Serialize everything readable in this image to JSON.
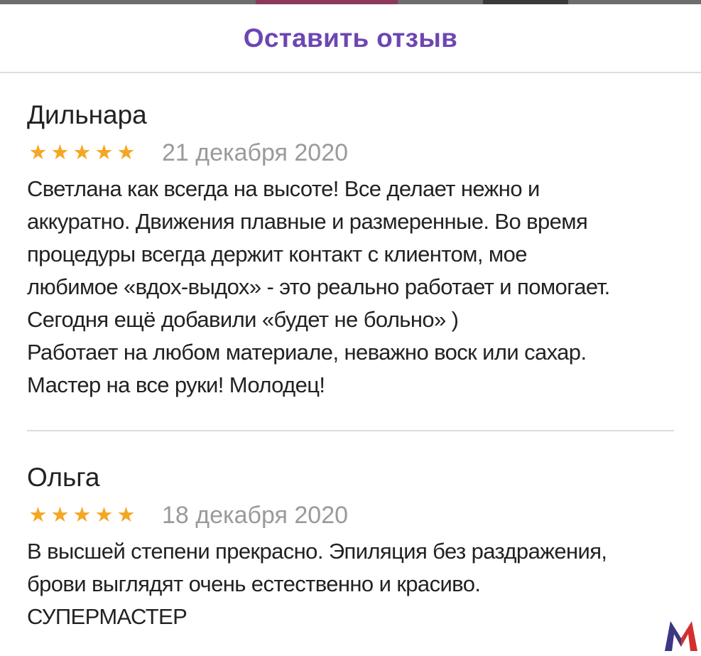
{
  "header": {
    "leave_review_label": "Оставить отзыв"
  },
  "reviews": [
    {
      "author": "Дильнара",
      "rating": 5,
      "stars": [
        "★",
        "★",
        "★",
        "★",
        "★"
      ],
      "date": "21 декабря 2020",
      "lines": [
        "Светлана как всегда на высоте! Все делает нежно и",
        "аккуратно. Движения плавные и размеренные. Во время",
        "процедуры всегда держит контакт с клиентом, мое",
        "любимое «вдох-выдох» - это реально работает и помогает.",
        "Сегодня ещё добавили «будет не больно» )",
        "Работает на любом материале, неважно воск или сахар.",
        "Мастер на все руки! Молодец!"
      ]
    },
    {
      "author": "Ольга",
      "rating": 5,
      "stars": [
        "★",
        "★",
        "★",
        "★",
        "★"
      ],
      "date": "18 декабря 2020",
      "lines": [
        "В высшей степени прекрасно. Эпиляция без раздражения,",
        "брови выглядят очень естественно и красиво.",
        "СУПЕРМАСТЕР"
      ]
    }
  ],
  "colors": {
    "accent": "#6d46b3",
    "star": "#f5a623",
    "date": "#9a9a9a",
    "divider": "#dcdcdc",
    "logo_red": "#d32f2f",
    "logo_blue": "#1f3a93"
  },
  "icons": {
    "star": "star-icon",
    "logo": "metro-logo-icon"
  }
}
